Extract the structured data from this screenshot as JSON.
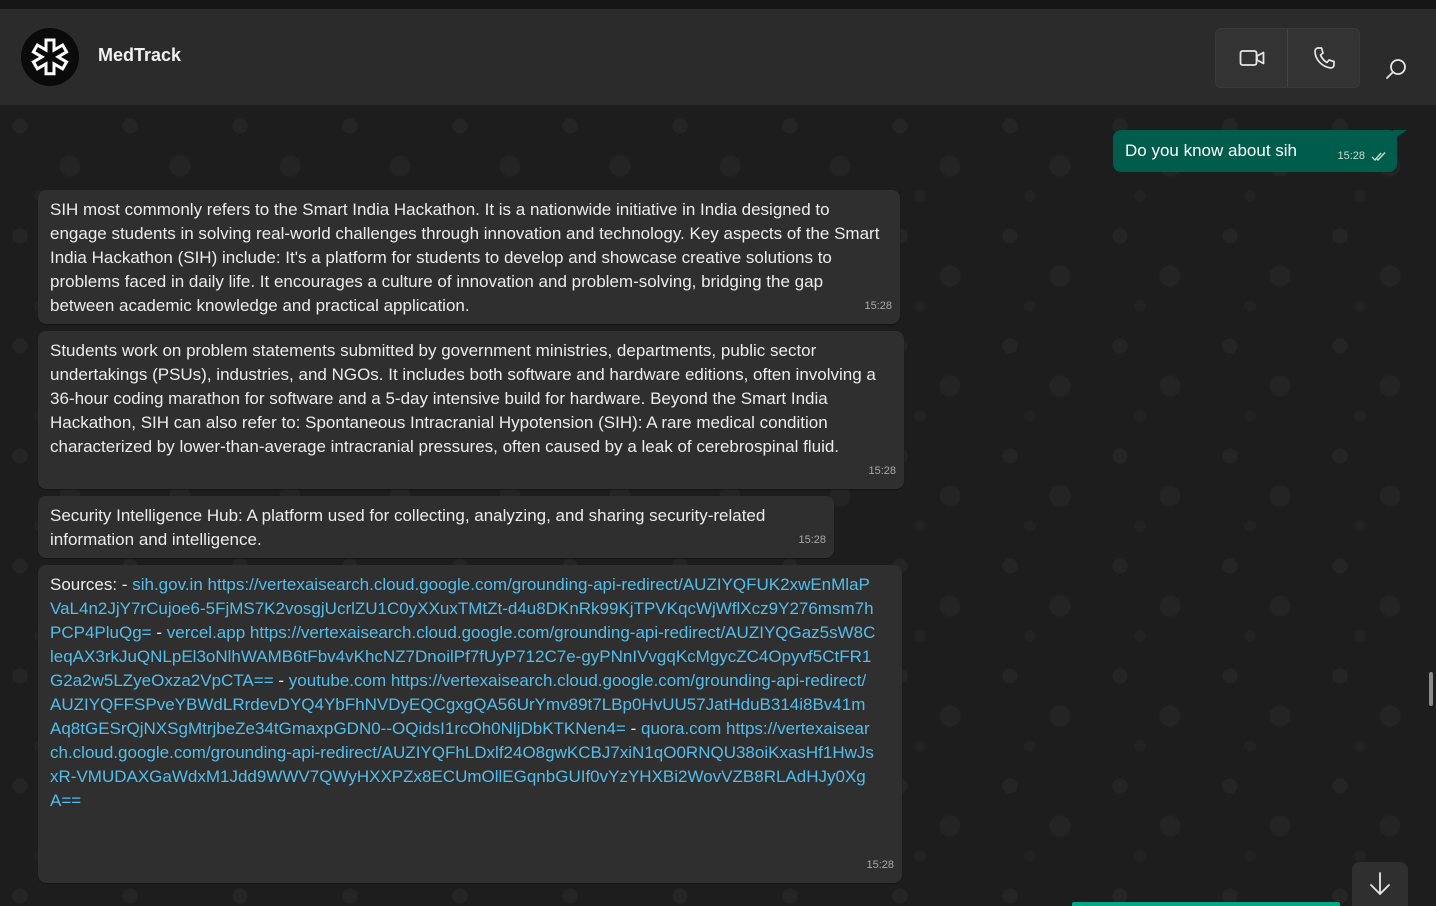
{
  "header": {
    "title": "MedTrack",
    "avatar_icon": "medical-star-icon",
    "actions": [
      "video-call-icon",
      "voice-call-icon",
      "search-icon"
    ]
  },
  "messages": {
    "outgoing": {
      "text": "Do you know about sih",
      "time": "15:28",
      "status_icon": "double-check-icon"
    },
    "incoming": [
      {
        "text": "SIH most commonly refers to the Smart India Hackathon.  It is a nationwide initiative in India designed to engage students in solving real-world challenges through innovation and technology.  Key aspects of the Smart India Hackathon (SIH) include: It's a platform for students to develop and showcase creative solutions to problems faced in daily life.  It encourages a culture of innovation and problem-solving, bridging the gap between academic knowledge and practical application.",
        "time": "15:28"
      },
      {
        "text": "Students work on problem statements submitted by government ministries, departments, public sector undertakings (PSUs), industries, and NGOs.  It includes both software and hardware editions, often involving a 36-hour coding marathon for software and a 5-day intensive build for hardware.  Beyond the Smart India Hackathon, SIH can also refer to: Spontaneous Intracranial Hypotension (SIH): A rare medical condition characterized by lower-than-average intracranial pressures, often caused by a leak of cerebrospinal fluid.",
        "time": "15:28"
      },
      {
        "text": "Security Intelligence Hub: A platform used for collecting, analyzing, and sharing security-related information and intelligence.",
        "time": "15:28"
      }
    ],
    "sources": {
      "prefix": "Sources: -",
      "sep": "-",
      "items": [
        {
          "label": "sih.gov.in",
          "url": "https://vertexaisearch.cloud.google.com/grounding-api-redirect/AUZIYQFUK2xwEnMlaPVaL4n2JjY7rCujoe6-5FjMS7K2vosgjUcrlZU1C0yXXuxTMtZt-d4u8DKnRk99KjTPVKqcWjWflXcz9Y276msm7hPCP4PluQg="
        },
        {
          "label": "vercel.app",
          "url": "https://vertexaisearch.cloud.google.com/grounding-api-redirect/AUZIYQGaz5sW8CleqAX3rkJuQNLpEl3oNlhWAMB6tFbv4vKhcNZ7DnoilPf7fUyP712C7e-gyPNnIVvgqKcMgycZC4Opyvf5CtFR1G2a2w5LZyeOxza2VpCTA=="
        },
        {
          "label": "youtube.com",
          "url": "https://vertexaisearch.cloud.google.com/grounding-api-redirect/AUZIYQFFSPveYBWdLRrdevDYQ4YbFhNVDyEQCgxgQA56UrYmv89t7LBp0HvUU57JatHduB314i8Bv41mAq8tGESrQjNXSgMtrjbeZe34tGmaxpGDN0--OQidsI1rcOh0NljDbKTKNen4="
        },
        {
          "label": "quora.com",
          "url": "https://vertexaisearch.cloud.google.com/grounding-api-redirect/AUZIYQFhLDxlf24O8gwKCBJ7xiN1qO0RNQU38oiKxasHf1HwJsxR-VMUDAXGaWdxM1Jdd9WWV7QWyHXXPZx8ECUmOllEGqnbGUIf0vYzYHXBi2WovVZB8RLAdHJy0XgA=="
        }
      ],
      "time": "15:28"
    }
  },
  "colors": {
    "outgoing_bubble": "#005c4b",
    "incoming_bubble": "#2f2f2f",
    "link": "#53bdeb",
    "accent": "#00a884"
  },
  "scroll_down_icon": "arrow-down-icon"
}
